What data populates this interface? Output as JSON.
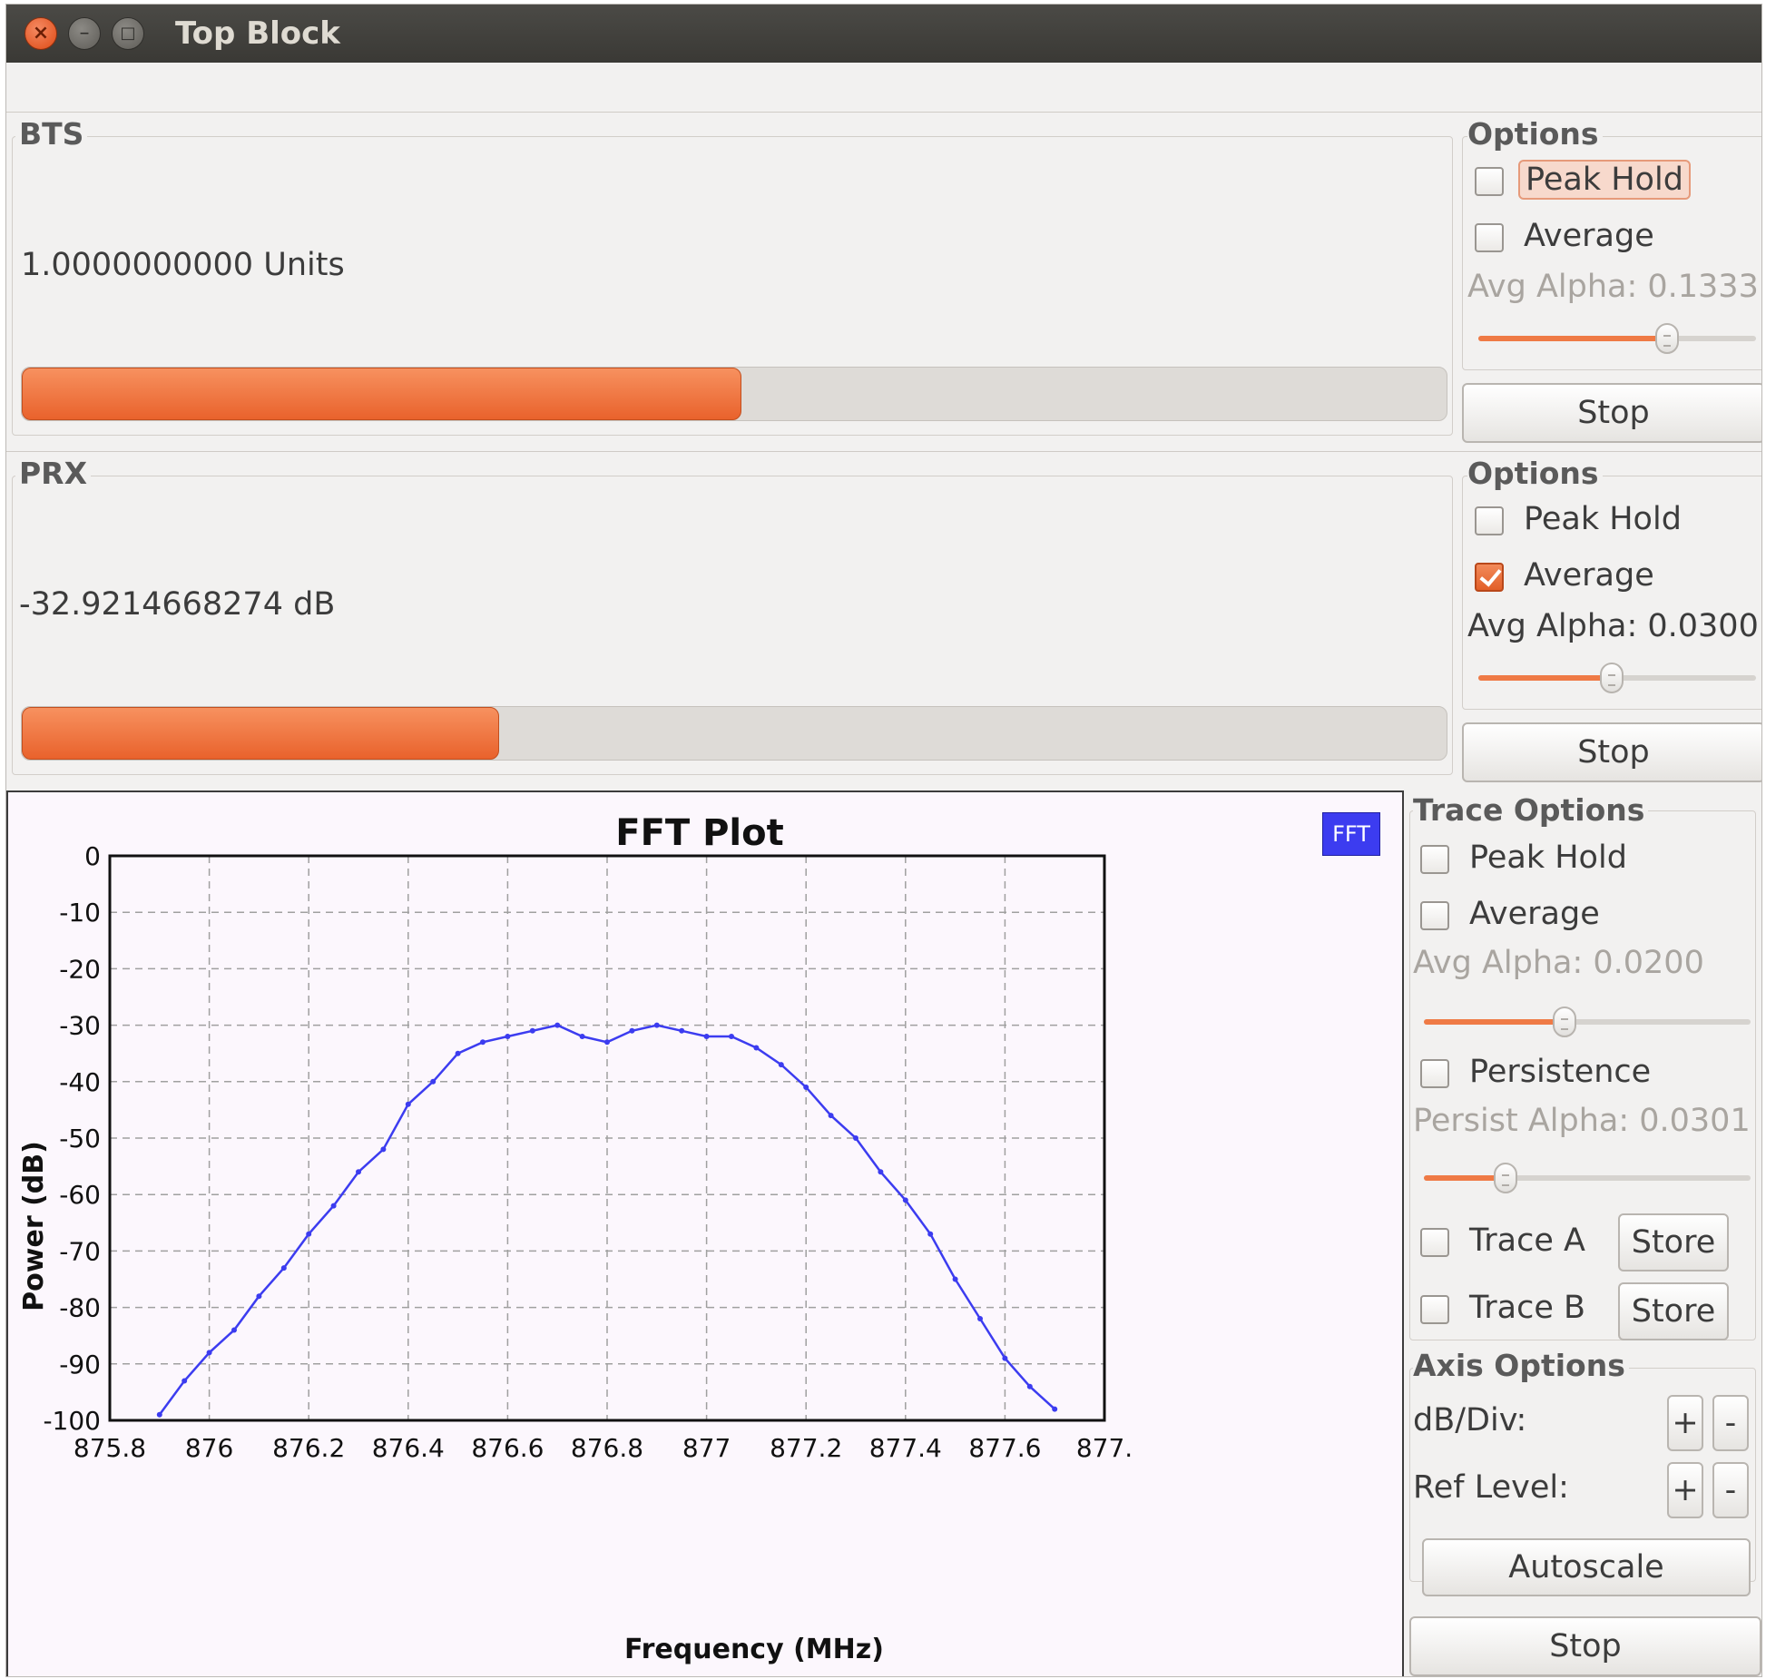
{
  "window": {
    "title": "Top Block"
  },
  "probes": [
    {
      "label": "BTS",
      "value_text": "1.0000000000 Units",
      "level_fraction": 0.505,
      "options": {
        "title": "Options",
        "peak_hold_label": "Peak Hold",
        "peak_hold_checked": false,
        "average_label": "Average",
        "average_checked": false,
        "avg_alpha_text": "Avg Alpha: 0.1333",
        "avg_alpha_fraction": 0.68,
        "stop_label": "Stop"
      }
    },
    {
      "label": "PRX",
      "value_text": "-32.9214668274 dB",
      "level_fraction": 0.335,
      "options": {
        "title": "Options",
        "peak_hold_label": "Peak Hold",
        "peak_hold_checked": false,
        "average_label": "Average",
        "average_checked": true,
        "avg_alpha_text": "Avg Alpha: 0.0300",
        "avg_alpha_fraction": 0.48,
        "stop_label": "Stop"
      }
    }
  ],
  "fft": {
    "legend_label": "FFT",
    "trace_options": {
      "title": "Trace Options",
      "peak_hold_label": "Peak Hold",
      "average_label": "Average",
      "avg_alpha_text": "Avg Alpha: 0.0200",
      "avg_alpha_fraction": 0.43,
      "persistence_label": "Persistence",
      "persist_alpha_text": "Persist Alpha: 0.0301",
      "persist_alpha_fraction": 0.25,
      "trace_a_label": "Trace A",
      "trace_b_label": "Trace B",
      "store_label": "Store"
    },
    "axis_options": {
      "title": "Axis Options",
      "db_div_label": "dB/Div:",
      "ref_level_label": "Ref Level:",
      "plus_label": "+",
      "minus_label": "-",
      "autoscale_label": "Autoscale"
    },
    "stop_label": "Stop"
  },
  "colors": {
    "accent": "#e9622c",
    "trace": "#3c3cf0",
    "plot_background": "#fcf7fd"
  },
  "chart_data": {
    "type": "line",
    "title": "FFT Plot",
    "xlabel": "Frequency (MHz)",
    "ylabel": "Power (dB)",
    "xlim": [
      875.8,
      877.8
    ],
    "ylim": [
      -100,
      0
    ],
    "x_ticks": [
      "875.8",
      "876",
      "876.2",
      "876.4",
      "876.6",
      "876.8",
      "877",
      "877.2",
      "877.4",
      "877.6",
      "877."
    ],
    "y_ticks": [
      "0",
      "-10",
      "-20",
      "-30",
      "-40",
      "-50",
      "-60",
      "-70",
      "-80",
      "-90",
      "-100"
    ],
    "grid": true,
    "series": [
      {
        "name": "FFT",
        "x": [
          875.9,
          875.95,
          876.0,
          876.05,
          876.1,
          876.15,
          876.2,
          876.25,
          876.3,
          876.35,
          876.4,
          876.45,
          876.5,
          876.55,
          876.6,
          876.65,
          876.7,
          876.75,
          876.8,
          876.85,
          876.9,
          876.95,
          877.0,
          877.05,
          877.1,
          877.15,
          877.2,
          877.25,
          877.3,
          877.35,
          877.4,
          877.45,
          877.5,
          877.55,
          877.6,
          877.65,
          877.7
        ],
        "y": [
          -99,
          -93,
          -88,
          -84,
          -78,
          -73,
          -67,
          -62,
          -56,
          -52,
          -44,
          -40,
          -35,
          -33,
          -32,
          -31,
          -30,
          -32,
          -33,
          -31,
          -30,
          -31,
          -32,
          -32,
          -34,
          -37,
          -41,
          -46,
          -50,
          -56,
          -61,
          -67,
          -75,
          -82,
          -89,
          -94,
          -98
        ]
      }
    ]
  }
}
